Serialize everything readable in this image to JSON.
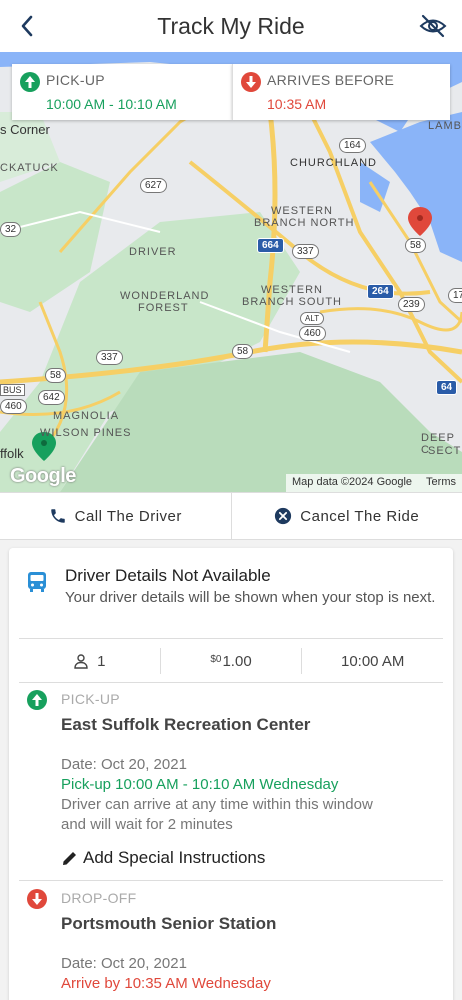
{
  "header": {
    "title": "Track My Ride"
  },
  "map": {
    "pickup_label": "PICK-UP",
    "pickup_time": "10:00 AM - 10:10 AM",
    "arrive_label": "ARRIVES BEFORE",
    "arrive_time": "10:35 AM",
    "labels": {
      "corner": "s Corner",
      "ckatuck": "CKATUCK",
      "churchland": "CHURCHLAND",
      "lamb": "LAMB",
      "wbn1": "WESTERN",
      "wbn2": "BRANCH NORTH",
      "driver": "DRIVER",
      "wf1": "WONDERLAND",
      "wf2": "FOREST",
      "wbs1": "WESTERN",
      "wbs2": "BRANCH SOUTH",
      "magnolia": "MAGNOLIA",
      "wilson": "WILSON PINES",
      "ffolk": "ffolk",
      "deep": "DEEP C",
      "sect": "SECT",
      "bus": "BUS"
    },
    "shields": {
      "s164": "164",
      "s627": "627",
      "s32": "32",
      "s664": "664",
      "s337a": "337",
      "s58a": "58",
      "s264": "264",
      "s239": "239",
      "s17": "17",
      "salt": "ALT",
      "s460a": "460",
      "s58b": "58",
      "s337b": "337",
      "s58c": "58",
      "s642": "642",
      "s460b": "460",
      "s64": "64"
    },
    "attribution": "Map data ©2024 Google",
    "terms": "Terms",
    "google": "Google"
  },
  "actions": {
    "call": "Call The Driver",
    "cancel": "Cancel The Ride"
  },
  "driver": {
    "title": "Driver Details Not Available",
    "subtitle": "Your driver details will be shown when your stop is next."
  },
  "stats": {
    "passengers": "1",
    "fare_currency": "$0",
    "fare": "1.00",
    "time": "10:00 AM"
  },
  "pickup": {
    "label": "PICK-UP",
    "name": "East Suffolk Recreation Center",
    "date": "Date: Oct 20, 2021",
    "window": "Pick-up 10:00 AM - 10:10 AM Wednesday",
    "note1": "Driver can arrive at any time within this window",
    "note2": "and will wait for 2 minutes",
    "add_instructions": "Add Special Instructions"
  },
  "dropoff": {
    "label": "DROP-OFF",
    "name": "Portsmouth Senior Station",
    "date": "Date: Oct 20, 2021",
    "arrive": "Arrive by 10:35 AM Wednesday"
  },
  "colors": {
    "green": "#17a05d",
    "red": "#e0483b",
    "water": "#8ab4f8",
    "park": "#c8e6c9",
    "road": "#f6cf65"
  }
}
